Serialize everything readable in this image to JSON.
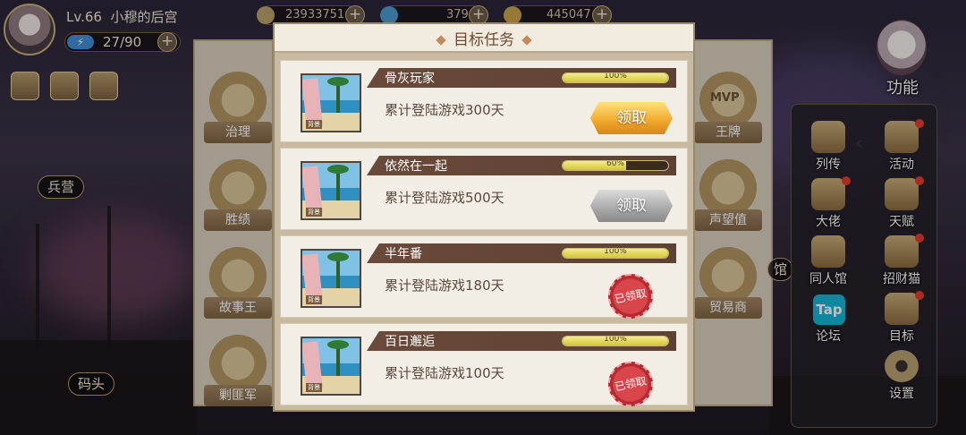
{
  "player": {
    "level": "Lv.66",
    "name": "小穆的后宫",
    "energy": "27/90"
  },
  "resources": [
    {
      "value": "23933751",
      "icon": "coin-icon"
    },
    {
      "value": "379",
      "icon": "gem-icon"
    },
    {
      "value": "445047",
      "icon": "gold-icon"
    }
  ],
  "left_labels": {
    "barracks": "兵营",
    "dock": "码头"
  },
  "left_panel": [
    "治理",
    "胜绩",
    "故事王",
    "剿匪军"
  ],
  "right_bg_panel": [
    "王牌",
    "声望值",
    "贸易商"
  ],
  "right_bg_fragment": "馆",
  "mvp_text": "MVP",
  "func_button": "功能",
  "menu": [
    {
      "label": "列传",
      "icon": "book-icon"
    },
    {
      "label": "活动",
      "icon": "star-medal-icon"
    },
    {
      "label": "大佬",
      "icon": "boss-icon"
    },
    {
      "label": "天赋",
      "icon": "talent-icon"
    },
    {
      "label": "同人馆",
      "icon": "fan-hall-icon"
    },
    {
      "label": "招财猫",
      "icon": "lucky-cat-icon"
    },
    {
      "label": "论坛",
      "icon": "tap-forum-icon",
      "tap": "Tap"
    },
    {
      "label": "目标",
      "icon": "target-scroll-icon"
    },
    {
      "label": "设置",
      "icon": "gear-icon"
    }
  ],
  "dialog": {
    "title": "目标任务",
    "tasks": [
      {
        "name": "骨灰玩家",
        "progress": 1.0,
        "progress_text": "100%",
        "desc": "累计登陆游戏300天",
        "status": "claimable",
        "button": "领取"
      },
      {
        "name": "依然在一起",
        "progress": 0.6,
        "progress_text": "60%",
        "desc": "累计登陆游戏500天",
        "status": "locked",
        "button": "领取"
      },
      {
        "name": "半年番",
        "progress": 1.0,
        "progress_text": "100%",
        "desc": "累计登陆游戏180天",
        "status": "claimed",
        "stamp": "已领取"
      },
      {
        "name": "百日邂逅",
        "progress": 1.0,
        "progress_text": "100%",
        "desc": "累计登陆游戏100天",
        "status": "claimed",
        "stamp": "已领取"
      }
    ],
    "thumb_tag": "背景"
  },
  "colors": {
    "accent_gold": "#f0a72b",
    "title_bar": "#6a4a3a",
    "stamp_red": "#d8454a"
  }
}
